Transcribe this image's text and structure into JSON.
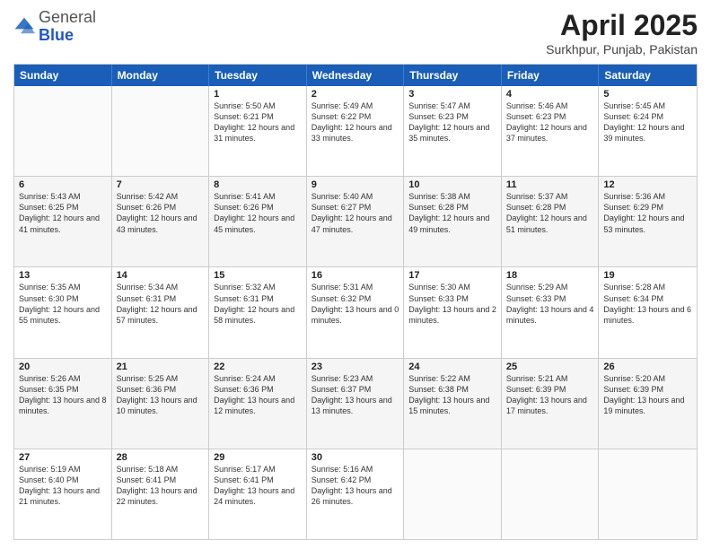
{
  "logo": {
    "general": "General",
    "blue": "Blue"
  },
  "title": "April 2025",
  "subtitle": "Surkhpur, Punjab, Pakistan",
  "header_days": [
    "Sunday",
    "Monday",
    "Tuesday",
    "Wednesday",
    "Thursday",
    "Friday",
    "Saturday"
  ],
  "rows": [
    [
      {
        "day": "",
        "sunrise": "",
        "sunset": "",
        "daylight": ""
      },
      {
        "day": "",
        "sunrise": "",
        "sunset": "",
        "daylight": ""
      },
      {
        "day": "1",
        "sunrise": "Sunrise: 5:50 AM",
        "sunset": "Sunset: 6:21 PM",
        "daylight": "Daylight: 12 hours and 31 minutes."
      },
      {
        "day": "2",
        "sunrise": "Sunrise: 5:49 AM",
        "sunset": "Sunset: 6:22 PM",
        "daylight": "Daylight: 12 hours and 33 minutes."
      },
      {
        "day": "3",
        "sunrise": "Sunrise: 5:47 AM",
        "sunset": "Sunset: 6:23 PM",
        "daylight": "Daylight: 12 hours and 35 minutes."
      },
      {
        "day": "4",
        "sunrise": "Sunrise: 5:46 AM",
        "sunset": "Sunset: 6:23 PM",
        "daylight": "Daylight: 12 hours and 37 minutes."
      },
      {
        "day": "5",
        "sunrise": "Sunrise: 5:45 AM",
        "sunset": "Sunset: 6:24 PM",
        "daylight": "Daylight: 12 hours and 39 minutes."
      }
    ],
    [
      {
        "day": "6",
        "sunrise": "Sunrise: 5:43 AM",
        "sunset": "Sunset: 6:25 PM",
        "daylight": "Daylight: 12 hours and 41 minutes."
      },
      {
        "day": "7",
        "sunrise": "Sunrise: 5:42 AM",
        "sunset": "Sunset: 6:26 PM",
        "daylight": "Daylight: 12 hours and 43 minutes."
      },
      {
        "day": "8",
        "sunrise": "Sunrise: 5:41 AM",
        "sunset": "Sunset: 6:26 PM",
        "daylight": "Daylight: 12 hours and 45 minutes."
      },
      {
        "day": "9",
        "sunrise": "Sunrise: 5:40 AM",
        "sunset": "Sunset: 6:27 PM",
        "daylight": "Daylight: 12 hours and 47 minutes."
      },
      {
        "day": "10",
        "sunrise": "Sunrise: 5:38 AM",
        "sunset": "Sunset: 6:28 PM",
        "daylight": "Daylight: 12 hours and 49 minutes."
      },
      {
        "day": "11",
        "sunrise": "Sunrise: 5:37 AM",
        "sunset": "Sunset: 6:28 PM",
        "daylight": "Daylight: 12 hours and 51 minutes."
      },
      {
        "day": "12",
        "sunrise": "Sunrise: 5:36 AM",
        "sunset": "Sunset: 6:29 PM",
        "daylight": "Daylight: 12 hours and 53 minutes."
      }
    ],
    [
      {
        "day": "13",
        "sunrise": "Sunrise: 5:35 AM",
        "sunset": "Sunset: 6:30 PM",
        "daylight": "Daylight: 12 hours and 55 minutes."
      },
      {
        "day": "14",
        "sunrise": "Sunrise: 5:34 AM",
        "sunset": "Sunset: 6:31 PM",
        "daylight": "Daylight: 12 hours and 57 minutes."
      },
      {
        "day": "15",
        "sunrise": "Sunrise: 5:32 AM",
        "sunset": "Sunset: 6:31 PM",
        "daylight": "Daylight: 12 hours and 58 minutes."
      },
      {
        "day": "16",
        "sunrise": "Sunrise: 5:31 AM",
        "sunset": "Sunset: 6:32 PM",
        "daylight": "Daylight: 13 hours and 0 minutes."
      },
      {
        "day": "17",
        "sunrise": "Sunrise: 5:30 AM",
        "sunset": "Sunset: 6:33 PM",
        "daylight": "Daylight: 13 hours and 2 minutes."
      },
      {
        "day": "18",
        "sunrise": "Sunrise: 5:29 AM",
        "sunset": "Sunset: 6:33 PM",
        "daylight": "Daylight: 13 hours and 4 minutes."
      },
      {
        "day": "19",
        "sunrise": "Sunrise: 5:28 AM",
        "sunset": "Sunset: 6:34 PM",
        "daylight": "Daylight: 13 hours and 6 minutes."
      }
    ],
    [
      {
        "day": "20",
        "sunrise": "Sunrise: 5:26 AM",
        "sunset": "Sunset: 6:35 PM",
        "daylight": "Daylight: 13 hours and 8 minutes."
      },
      {
        "day": "21",
        "sunrise": "Sunrise: 5:25 AM",
        "sunset": "Sunset: 6:36 PM",
        "daylight": "Daylight: 13 hours and 10 minutes."
      },
      {
        "day": "22",
        "sunrise": "Sunrise: 5:24 AM",
        "sunset": "Sunset: 6:36 PM",
        "daylight": "Daylight: 13 hours and 12 minutes."
      },
      {
        "day": "23",
        "sunrise": "Sunrise: 5:23 AM",
        "sunset": "Sunset: 6:37 PM",
        "daylight": "Daylight: 13 hours and 13 minutes."
      },
      {
        "day": "24",
        "sunrise": "Sunrise: 5:22 AM",
        "sunset": "Sunset: 6:38 PM",
        "daylight": "Daylight: 13 hours and 15 minutes."
      },
      {
        "day": "25",
        "sunrise": "Sunrise: 5:21 AM",
        "sunset": "Sunset: 6:39 PM",
        "daylight": "Daylight: 13 hours and 17 minutes."
      },
      {
        "day": "26",
        "sunrise": "Sunrise: 5:20 AM",
        "sunset": "Sunset: 6:39 PM",
        "daylight": "Daylight: 13 hours and 19 minutes."
      }
    ],
    [
      {
        "day": "27",
        "sunrise": "Sunrise: 5:19 AM",
        "sunset": "Sunset: 6:40 PM",
        "daylight": "Daylight: 13 hours and 21 minutes."
      },
      {
        "day": "28",
        "sunrise": "Sunrise: 5:18 AM",
        "sunset": "Sunset: 6:41 PM",
        "daylight": "Daylight: 13 hours and 22 minutes."
      },
      {
        "day": "29",
        "sunrise": "Sunrise: 5:17 AM",
        "sunset": "Sunset: 6:41 PM",
        "daylight": "Daylight: 13 hours and 24 minutes."
      },
      {
        "day": "30",
        "sunrise": "Sunrise: 5:16 AM",
        "sunset": "Sunset: 6:42 PM",
        "daylight": "Daylight: 13 hours and 26 minutes."
      },
      {
        "day": "",
        "sunrise": "",
        "sunset": "",
        "daylight": ""
      },
      {
        "day": "",
        "sunrise": "",
        "sunset": "",
        "daylight": ""
      },
      {
        "day": "",
        "sunrise": "",
        "sunset": "",
        "daylight": ""
      }
    ]
  ]
}
